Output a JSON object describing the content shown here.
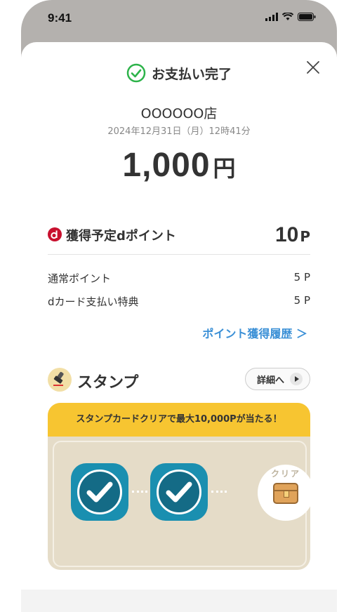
{
  "status_bar": {
    "time": "9:41"
  },
  "header": {
    "title": "お支払い完了"
  },
  "payment": {
    "store": "OOOOOO店",
    "datetime": "2024年12月31日（月）12時41分",
    "amount": "1,000",
    "currency": "円"
  },
  "points": {
    "label": "獲得予定dポイント",
    "total": "10",
    "unit": "P",
    "rows": [
      {
        "label": "通常ポイント",
        "value": "5 P"
      },
      {
        "label": "dカード支払い特典",
        "value": "5 P"
      }
    ],
    "history_link": "ポイント獲得履歴 ＞"
  },
  "stamp": {
    "title": "スタンプ",
    "detail_button": "詳細へ",
    "banner": "スタンプカードクリアで最大10,000Pが当たる！",
    "clear_label": "クリア",
    "stamps_collected": 2,
    "stamps_total": 3
  },
  "colors": {
    "check_green": "#2db34a",
    "link_blue": "#3a8fd6",
    "banner_yellow": "#f7c531",
    "stamp_blue": "#1a8fb0",
    "d_red": "#c8102e"
  }
}
